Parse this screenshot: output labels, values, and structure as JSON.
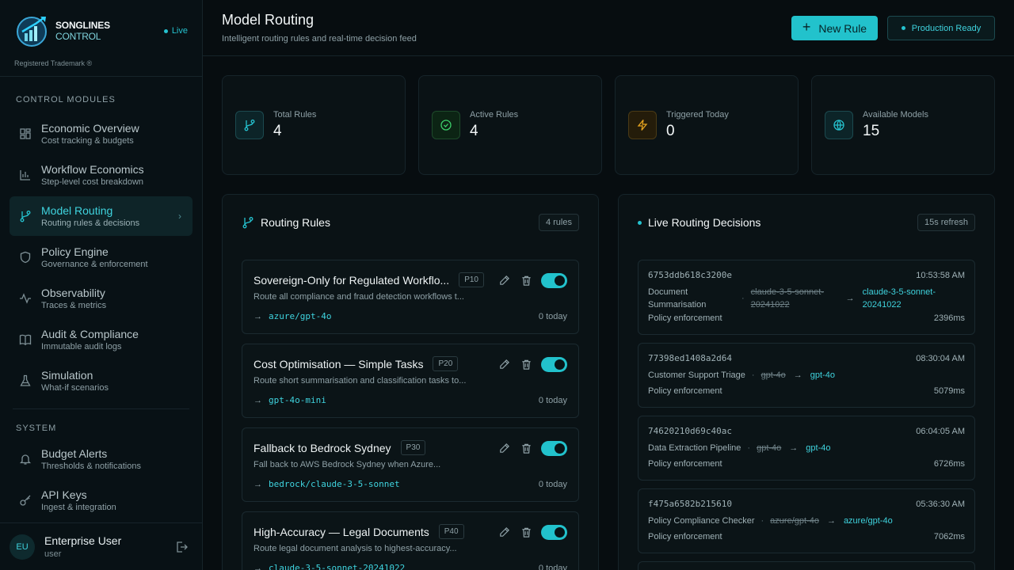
{
  "brand": {
    "name_bold": "SONGLINES",
    "name_light": "CONTROL",
    "live": "Live",
    "trademark": "Registered Trademark ®"
  },
  "sidebar": {
    "section_modules": "CONTROL MODULES",
    "section_system": "SYSTEM",
    "items": [
      {
        "title": "Economic Overview",
        "sub": "Cost tracking & budgets",
        "icon": "dashboard-icon"
      },
      {
        "title": "Workflow Economics",
        "sub": "Step-level cost breakdown",
        "icon": "bar-chart-icon"
      },
      {
        "title": "Model Routing",
        "sub": "Routing rules & decisions",
        "icon": "git-branch-icon"
      },
      {
        "title": "Policy Engine",
        "sub": "Governance & enforcement",
        "icon": "shield-icon"
      },
      {
        "title": "Observability",
        "sub": "Traces & metrics",
        "icon": "activity-icon"
      },
      {
        "title": "Audit & Compliance",
        "sub": "Immutable audit logs",
        "icon": "book-icon"
      },
      {
        "title": "Simulation",
        "sub": "What-if scenarios",
        "icon": "flask-icon"
      }
    ],
    "system_items": [
      {
        "title": "Budget Alerts",
        "sub": "Thresholds & notifications",
        "icon": "bell-icon"
      },
      {
        "title": "API Keys",
        "sub": "Ingest & integration",
        "icon": "key-icon"
      }
    ]
  },
  "user": {
    "initials": "EU",
    "name": "Enterprise User",
    "role": "user"
  },
  "header": {
    "title": "Model Routing",
    "subtitle": "Intelligent routing rules and real-time decision feed",
    "new_rule": "New Rule",
    "status": "Production Ready"
  },
  "stats": [
    {
      "label": "Total Rules",
      "value": "4",
      "color": "#25c2cf"
    },
    {
      "label": "Active Rules",
      "value": "4",
      "color": "#3ccf6a"
    },
    {
      "label": "Triggered Today",
      "value": "0",
      "color": "#e6a41f"
    },
    {
      "label": "Available Models",
      "value": "15",
      "color": "#25c2cf"
    }
  ],
  "rules_panel": {
    "title": "Routing Rules",
    "count": "4 rules",
    "rules": [
      {
        "name": "Sovereign-Only for Regulated Workflo...",
        "priority": "P10",
        "desc": "Route all compliance and fraud detection workflows t...",
        "model": "azure/gpt-4o",
        "today": "0 today"
      },
      {
        "name": "Cost Optimisation — Simple Tasks",
        "priority": "P20",
        "desc": "Route short summarisation and classification tasks to...",
        "model": "gpt-4o-mini",
        "today": "0 today"
      },
      {
        "name": "Fallback to Bedrock Sydney",
        "priority": "P30",
        "desc": "Fall back to AWS Bedrock Sydney when Azure...",
        "model": "bedrock/claude-3-5-sonnet",
        "today": "0 today"
      },
      {
        "name": "High-Accuracy — Legal Documents",
        "priority": "P40",
        "desc": "Route legal document analysis to highest-accuracy...",
        "model": "claude-3-5-sonnet-20241022",
        "today": "0 today"
      }
    ]
  },
  "decisions_panel": {
    "title": "Live Routing Decisions",
    "refresh": "15s refresh",
    "decisions": [
      {
        "id": "6753ddb618c3200e",
        "time": "10:53:58 AM",
        "workflow": "Document Summarisation",
        "from": "claude-3-5-sonnet-20241022",
        "to": "claude-3-5-sonnet-20241022",
        "reason": "Policy enforcement",
        "latency": "2396ms"
      },
      {
        "id": "77398ed1408a2d64",
        "time": "08:30:04 AM",
        "workflow": "Customer Support Triage",
        "from": "gpt-4o",
        "to": "gpt-4o",
        "reason": "Policy enforcement",
        "latency": "5079ms"
      },
      {
        "id": "74620210d69c40ac",
        "time": "06:04:05 AM",
        "workflow": "Data Extraction Pipeline",
        "from": "gpt-4o",
        "to": "gpt-4o",
        "reason": "Policy enforcement",
        "latency": "6726ms"
      },
      {
        "id": "f475a6582b215610",
        "time": "05:36:30 AM",
        "workflow": "Policy Compliance Checker",
        "from": "azure/gpt-4o",
        "to": "azure/gpt-4o",
        "reason": "Policy enforcement",
        "latency": "7062ms"
      }
    ]
  }
}
